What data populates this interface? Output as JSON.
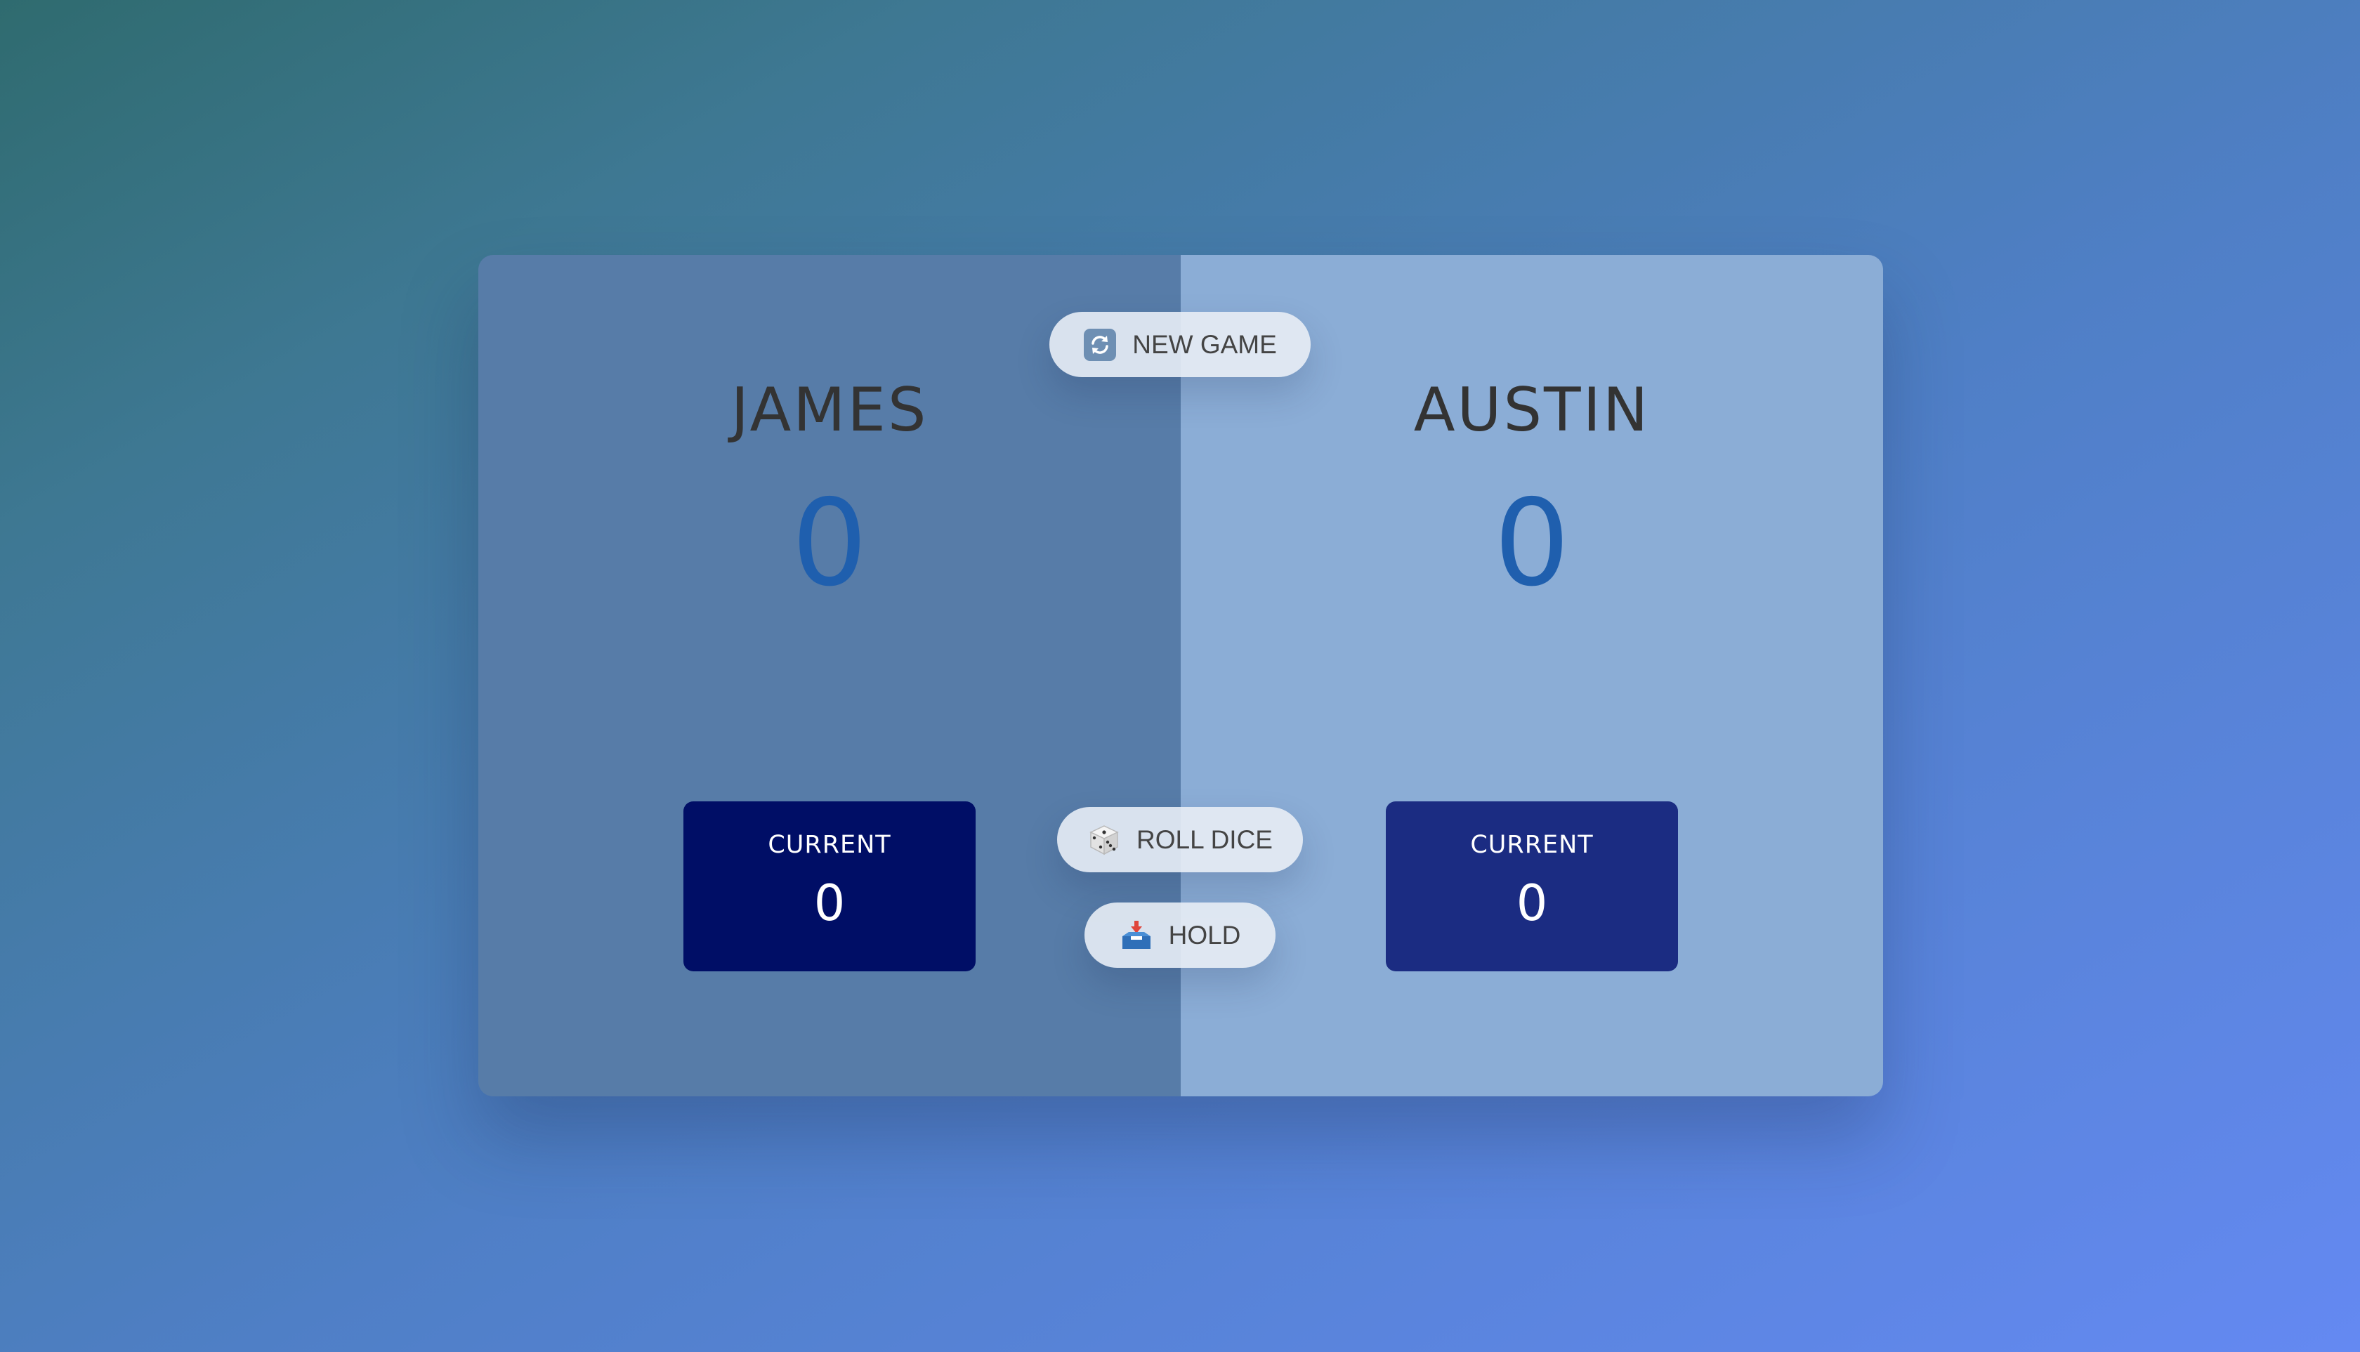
{
  "players": [
    {
      "name": "JAMES",
      "score": "0",
      "current_label": "CURRENT",
      "current_score": "0"
    },
    {
      "name": "AUSTIN",
      "score": "0",
      "current_label": "CURRENT",
      "current_score": "0"
    }
  ],
  "buttons": {
    "new_game": {
      "label": "NEW GAME",
      "icon": "refresh-icon"
    },
    "roll_dice": {
      "label": "ROLL DICE",
      "icon": "dice-icon"
    },
    "hold": {
      "label": "HOLD",
      "icon": "inbox-tray-icon"
    }
  },
  "colors": {
    "player0_panel": "#577ca8",
    "player1_panel": "#8badd6",
    "player0_current": "#000e66",
    "player1_current": "#1b2c82",
    "score_text": "#1f5fae"
  }
}
